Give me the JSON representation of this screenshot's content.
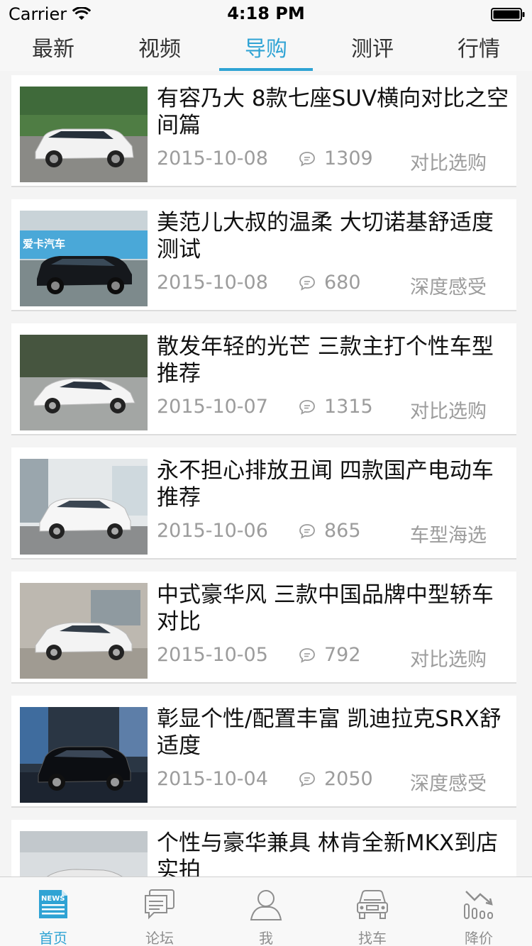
{
  "status_bar": {
    "carrier": "Carrier",
    "time": "4:18 PM"
  },
  "top_tabs": [
    "最新",
    "视频",
    "导购",
    "测评",
    "行情"
  ],
  "active_tab": "导购",
  "articles": [
    {
      "title": "有容乃大 8款七座SUV横向对比之空间篇",
      "date": "2015-10-08",
      "comments": "1309",
      "category": "对比选购"
    },
    {
      "title": "美范儿大叔的温柔 大切诺基舒适度测试",
      "date": "2015-10-08",
      "comments": "680",
      "category": "深度感受"
    },
    {
      "title": "散发年轻的光芒 三款主打个性车型推荐",
      "date": "2015-10-07",
      "comments": "1315",
      "category": "对比选购"
    },
    {
      "title": "永不担心排放丑闻 四款国产电动车推荐",
      "date": "2015-10-06",
      "comments": "865",
      "category": "车型海选"
    },
    {
      "title": "中式豪华风 三款中国品牌中型轿车对比",
      "date": "2015-10-05",
      "comments": "792",
      "category": "对比选购"
    },
    {
      "title": "彰显个性/配置丰富  凯迪拉克SRX舒适度",
      "date": "2015-10-04",
      "comments": "2050",
      "category": "深度感受"
    },
    {
      "title": "个性与豪华兼具 林肯全新MKX到店实拍",
      "date": "",
      "comments": "",
      "category": ""
    }
  ],
  "thumb_banner_text": "爱卡汽车",
  "bottom_tabs": [
    {
      "label": "首页",
      "icon": "news-icon",
      "active": true,
      "icon_text": "NEWS"
    },
    {
      "label": "论坛",
      "icon": "chat-bubbles-icon",
      "active": false
    },
    {
      "label": "我",
      "icon": "person-icon",
      "active": false
    },
    {
      "label": "找车",
      "icon": "car-front-icon",
      "active": false
    },
    {
      "label": "降价",
      "icon": "price-down-chart-icon",
      "active": false
    }
  ],
  "colors": {
    "accent": "#2fa3d4",
    "meta": "#9c9c9c",
    "title": "#111111",
    "background": "#f4f4f4"
  }
}
